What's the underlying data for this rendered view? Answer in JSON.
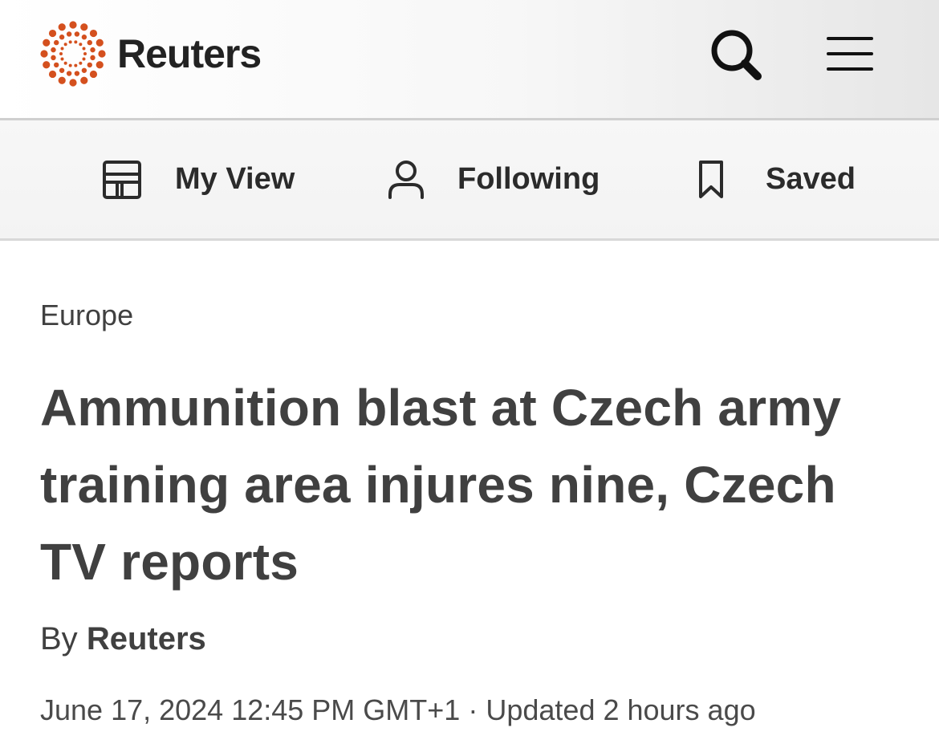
{
  "header": {
    "logo_text": "Reuters",
    "brand_color": "#d4501e",
    "search_icon": "search-icon",
    "menu_icon": "hamburger-menu-icon"
  },
  "nav": {
    "items": [
      {
        "label": "My View",
        "icon": "layout-icon"
      },
      {
        "label": "Following",
        "icon": "person-icon"
      },
      {
        "label": "Saved",
        "icon": "bookmark-icon"
      }
    ]
  },
  "article": {
    "section": "Europe",
    "headline": "Ammunition blast at Czech army training area injures nine, Czech TV reports",
    "byline_prefix": "By",
    "byline_author": "Reuters",
    "published": "June 17, 2024 12:45 PM GMT+1",
    "separator": "·",
    "updated": "Updated 2 hours ago"
  }
}
